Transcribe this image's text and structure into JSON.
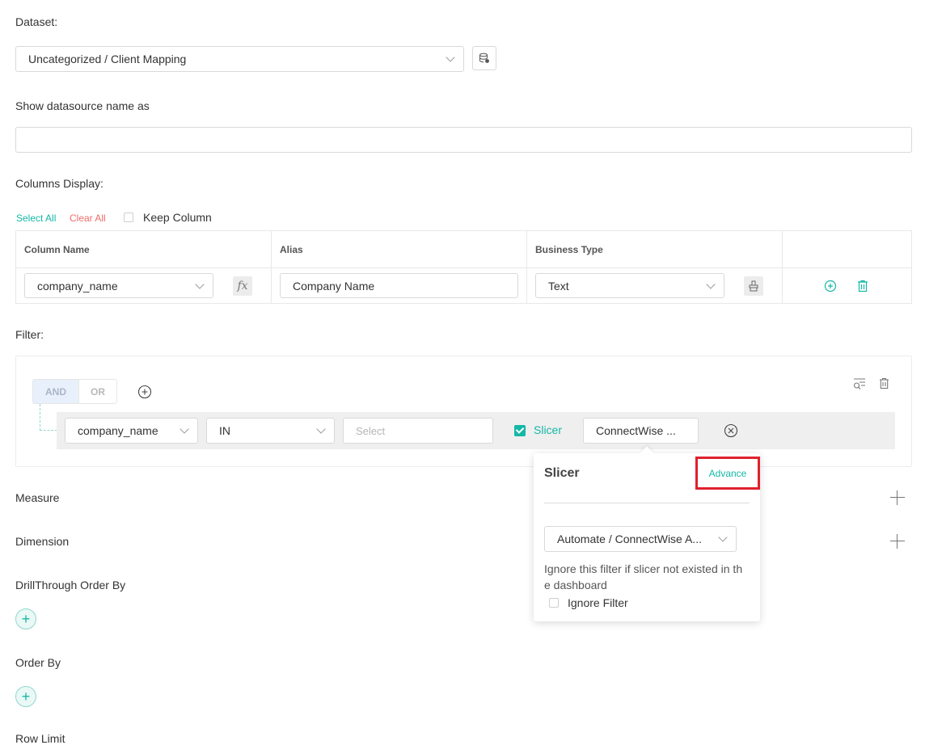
{
  "dataset": {
    "label": "Dataset:",
    "value": "Uncategorized / Client Mapping"
  },
  "datasource_name": {
    "label": "Show datasource name as",
    "value": ""
  },
  "columns": {
    "label": "Columns Display:",
    "select_all": "Select All",
    "clear_all": "Clear All",
    "keep_column": "Keep Column",
    "headers": [
      "Column Name",
      "Alias",
      "Business Type",
      ""
    ],
    "row": {
      "column_name": "company_name",
      "fx": "fx",
      "alias": "Company Name",
      "business_type": "Text"
    }
  },
  "filter": {
    "label": "Filter:",
    "and": "AND",
    "or": "OR",
    "field": "company_name",
    "operator": "IN",
    "value_placeholder": "Select",
    "slicer_label": "Slicer",
    "slicer_value": "ConnectWise ..."
  },
  "slicer_popup": {
    "title": "Slicer",
    "advance": "Advance",
    "selected": "Automate / ConnectWise A...",
    "help_line1": "Ignore this filter if slicer not existed in th",
    "help_line2": "e dashboard",
    "ignore_filter": "Ignore Filter"
  },
  "sections": {
    "measure": "Measure",
    "dimension": "Dimension",
    "drillthrough": "DrillThrough Order By",
    "order_by": "Order By",
    "row_limit": "Row Limit"
  },
  "colors": {
    "accent": "#14b8a6",
    "danger": "#f26b6b",
    "highlight": "#e0202e"
  }
}
